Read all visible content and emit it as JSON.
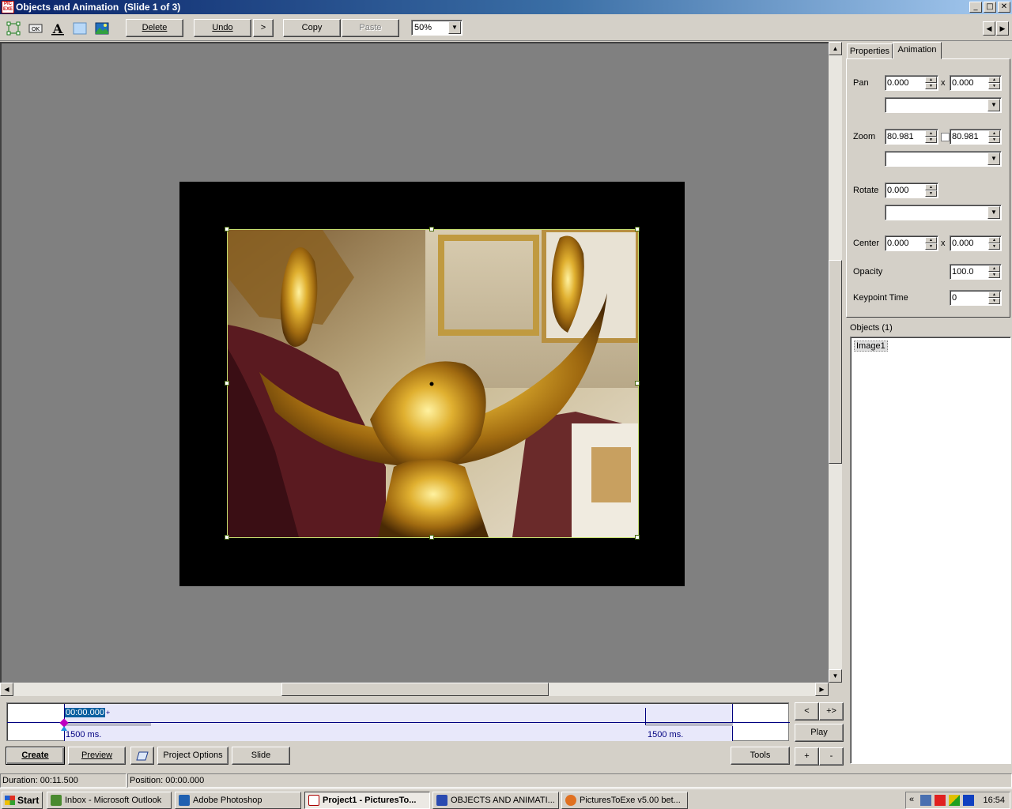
{
  "window": {
    "title": "Objects and Animation  (Slide 1 of 3)",
    "min": "_",
    "max": "□",
    "close": "✕"
  },
  "toolbar": {
    "delete": "Delete",
    "undo": "Undo",
    "redo": ">",
    "copy": "Copy",
    "paste": "Paste",
    "zoom_value": "50%",
    "prev": "◀",
    "next": "▶"
  },
  "tabs": {
    "properties": "Properties",
    "animation": "Animation"
  },
  "animation": {
    "pan_label": "Pan",
    "pan_x": "0.000",
    "pan_y": "0.000",
    "zoom_label": "Zoom",
    "zoom_x": "80.981",
    "zoom_y": "80.981",
    "rotate_label": "Rotate",
    "rotate_value": "0.000",
    "center_label": "Center",
    "center_x": "0.000",
    "center_y": "0.000",
    "opacity_label": "Opacity",
    "opacity_value": "100.0",
    "keypoint_label": "Keypoint Time",
    "keypoint_value": "0",
    "x_sep": "x"
  },
  "objects": {
    "header": "Objects (1)",
    "items": [
      "Image1"
    ]
  },
  "timeline": {
    "current_time": "00:00.000",
    "plus": "+",
    "left_duration": "1500 ms.",
    "right_duration": "1500 ms."
  },
  "side_buttons": {
    "prev": "<",
    "next_add": "+>",
    "play": "Play",
    "add": "+",
    "remove": "-"
  },
  "bottom_buttons": {
    "create": "Create",
    "preview": "Preview",
    "project_options": "Project Options",
    "slide": "Slide",
    "tools": "Tools"
  },
  "status": {
    "duration": "Duration:  00:11.500",
    "position": "Position:  00:00.000"
  },
  "taskbar": {
    "start": "Start",
    "tasks": [
      "Inbox - Microsoft Outlook",
      "Adobe Photoshop",
      "Project1 - PicturesTo...",
      "OBJECTS AND ANIMATI...",
      "PicturesToExe v5.00 bet..."
    ],
    "tray_chevron": "«",
    "clock": "16:54"
  }
}
